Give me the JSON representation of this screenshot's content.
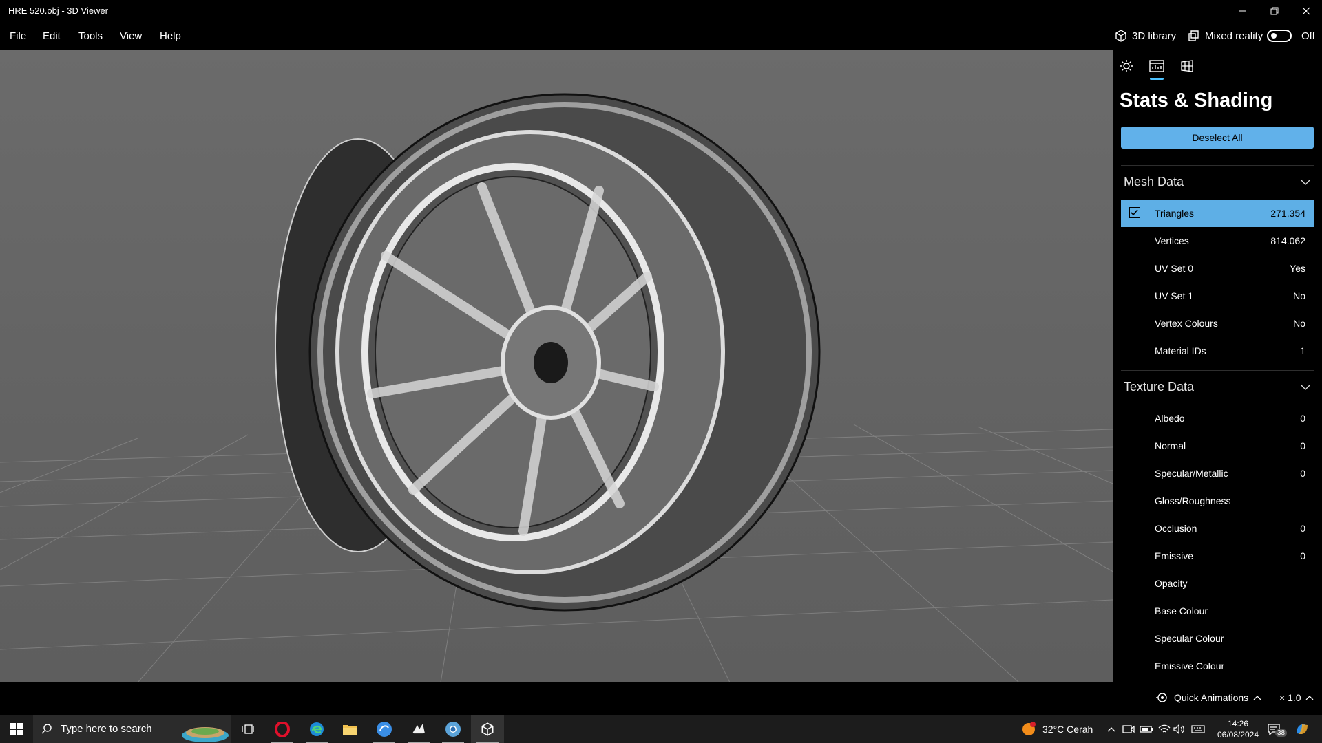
{
  "window": {
    "title": "HRE 520.obj - 3D Viewer"
  },
  "menu": {
    "items": [
      "File",
      "Edit",
      "Tools",
      "View",
      "Help"
    ]
  },
  "header_right": {
    "library_label": "3D library",
    "mixed_reality_label": "Mixed reality",
    "toggle_state": "Off"
  },
  "panel": {
    "title": "Stats & Shading",
    "deselect_label": "Deselect All",
    "mesh_section": "Mesh Data",
    "mesh_rows": [
      {
        "label": "Triangles",
        "value": "271.354"
      },
      {
        "label": "Vertices",
        "value": "814.062"
      },
      {
        "label": "UV Set 0",
        "value": "Yes"
      },
      {
        "label": "UV Set 1",
        "value": "No"
      },
      {
        "label": "Vertex Colours",
        "value": "No"
      },
      {
        "label": "Material IDs",
        "value": "1"
      }
    ],
    "texture_section": "Texture Data",
    "texture_rows": [
      {
        "label": "Albedo",
        "value": "0"
      },
      {
        "label": "Normal",
        "value": "0"
      },
      {
        "label": "Specular/Metallic",
        "value": "0"
      },
      {
        "label": "Gloss/Roughness",
        "value": ""
      },
      {
        "label": "Occlusion",
        "value": "0"
      },
      {
        "label": "Emissive",
        "value": "0"
      },
      {
        "label": "Opacity",
        "value": ""
      },
      {
        "label": "Base Colour",
        "value": ""
      },
      {
        "label": "Specular Colour",
        "value": ""
      },
      {
        "label": "Emissive Colour",
        "value": ""
      }
    ]
  },
  "statusbar": {
    "quick_animations_label": "Quick Animations",
    "speed": "× 1.0"
  },
  "taskbar": {
    "search_placeholder": "Type here to search",
    "weather": "32°C  Cerah",
    "time": "14:26",
    "date": "06/08/2024",
    "notifications": "38"
  },
  "colors": {
    "accent": "#4cc2ff",
    "selection": "#5eafe6",
    "button": "#61b1ea"
  }
}
